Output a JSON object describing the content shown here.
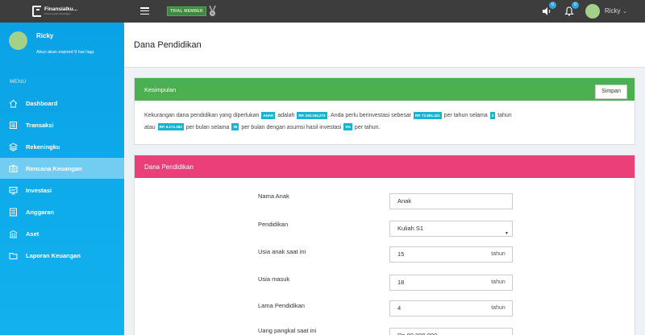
{
  "topbar": {
    "brand_name": "Finansialku...",
    "brand_tagline": "Perencanaan Keuangan",
    "trial_label": "TRIAL MEMBER",
    "icons": [
      "menu-icon",
      "medal-icon",
      "speaker-icon",
      "bell-icon"
    ],
    "speaker_badge": "0",
    "bell_badge": "0",
    "username": "Ricky",
    "caret": "⌄"
  },
  "sidebar": {
    "profile": {
      "name": "Ricky",
      "expiry": "Akun akan expired 9 hari lagi."
    },
    "menu_label": "MENU",
    "items": [
      {
        "label": "Dashboard",
        "icon": "home-icon",
        "active": false
      },
      {
        "label": "Transaksi",
        "icon": "list-icon",
        "active": false
      },
      {
        "label": "Rekeningku",
        "icon": "layers-icon",
        "active": false
      },
      {
        "label": "Rencana Keuangan",
        "icon": "camera-icon",
        "active": true
      },
      {
        "label": "Investasi",
        "icon": "monitor-icon",
        "active": false
      },
      {
        "label": "Anggaran",
        "icon": "ledger-icon",
        "active": false
      },
      {
        "label": "Aset",
        "icon": "building-icon",
        "active": false
      },
      {
        "label": "Laporan Keuangan",
        "icon": "folder-icon",
        "active": false
      }
    ]
  },
  "page": {
    "title": "Dana Pendidikan"
  },
  "summary": {
    "title": "Kesimpulan",
    "save_label": "Simpan",
    "t1": "Kekurangan dana pendidikan yang diperlukan",
    "tag_child": "ANAK",
    "t2": "adalah",
    "tag_shortfall": "RP. 240.154.273",
    "t3": ". Anda perlu berinvestasi sebesar",
    "tag_yearly": "RP. 72.551.421",
    "t4": "per tahun selama",
    "tag_years": "3",
    "t5": "tahun",
    "t6": "atau",
    "tag_monthly": "RP. 6.171.283",
    "t7": "per bulan selama",
    "tag_months": "36",
    "t8": "per bulan dengan asumsi hasil investasi",
    "tag_rate": "5%",
    "t9": "per tahun."
  },
  "form": {
    "title": "Dana Pendidikan",
    "fields": [
      {
        "label": "Nama Anak",
        "value": "Anak"
      },
      {
        "label": "Pendidikan",
        "value": "Kuliah S1",
        "caret": "▼"
      },
      {
        "label": "Usia anak saat ini",
        "value": "15",
        "unit": "tahun"
      },
      {
        "label": "Usia masuk",
        "value": "18",
        "unit": "tahun"
      },
      {
        "label": "Lama Pendidikan",
        "value": "4",
        "unit": "tahun"
      },
      {
        "label": "Uang pangkal saat ini",
        "value": "Rp 80.000.000"
      }
    ]
  }
}
